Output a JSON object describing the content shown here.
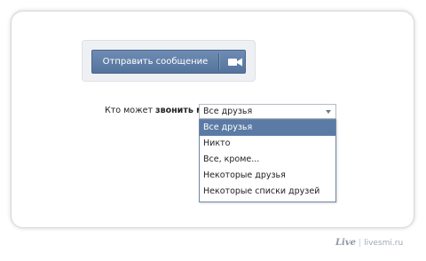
{
  "send_button": {
    "label": "Отправить сообщение",
    "icon": "video-camera-icon"
  },
  "call_setting": {
    "label_prefix": "Кто может ",
    "label_bold": "звонить мне",
    "selected_value": "Все друзья",
    "options": [
      "Все друзья",
      "Никто",
      "Все, кроме...",
      "Некоторые друзья",
      "Некоторые списки друзей"
    ],
    "highlighted_option": "Все друзья"
  },
  "watermark": {
    "logo_text": "Live",
    "site": "livesmi.ru"
  },
  "colors": {
    "button_blue": "#5d7ca5",
    "highlight_blue": "#5b7ba5",
    "dropdown_border": "#6f87a6"
  }
}
